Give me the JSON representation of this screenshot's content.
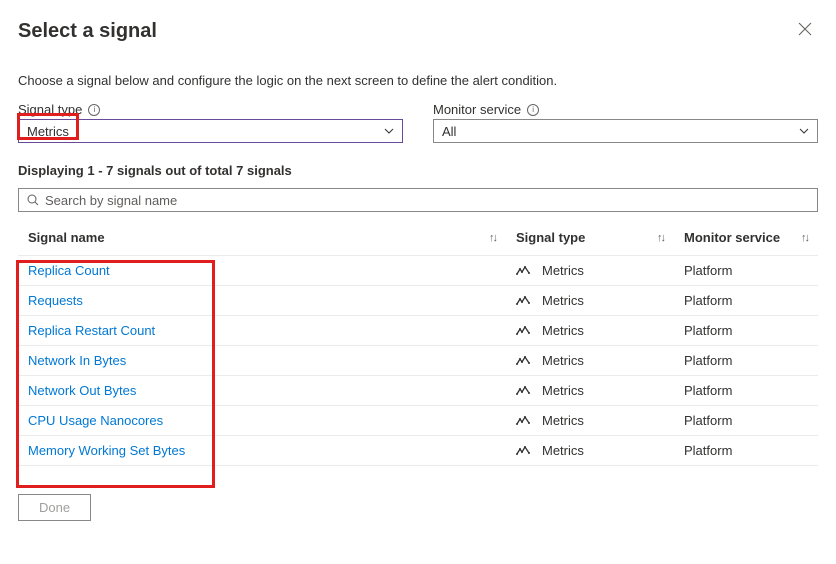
{
  "header": {
    "title": "Select a signal"
  },
  "description": "Choose a signal below and configure the logic on the next screen to define the alert condition.",
  "filters": {
    "signal_type": {
      "label": "Signal type",
      "value": "Metrics"
    },
    "monitor_service": {
      "label": "Monitor service",
      "value": "All"
    }
  },
  "summary": "Displaying 1 - 7 signals out of total 7 signals",
  "search": {
    "placeholder": "Search by signal name"
  },
  "columns": {
    "name": "Signal name",
    "type": "Signal type",
    "service": "Monitor service"
  },
  "signals": [
    {
      "name": "Replica Count",
      "type": "Metrics",
      "service": "Platform"
    },
    {
      "name": "Requests",
      "type": "Metrics",
      "service": "Platform"
    },
    {
      "name": "Replica Restart Count",
      "type": "Metrics",
      "service": "Platform"
    },
    {
      "name": "Network In Bytes",
      "type": "Metrics",
      "service": "Platform"
    },
    {
      "name": "Network Out Bytes",
      "type": "Metrics",
      "service": "Platform"
    },
    {
      "name": "CPU Usage Nanocores",
      "type": "Metrics",
      "service": "Platform"
    },
    {
      "name": "Memory Working Set Bytes",
      "type": "Metrics",
      "service": "Platform"
    }
  ],
  "footer": {
    "done": "Done"
  }
}
